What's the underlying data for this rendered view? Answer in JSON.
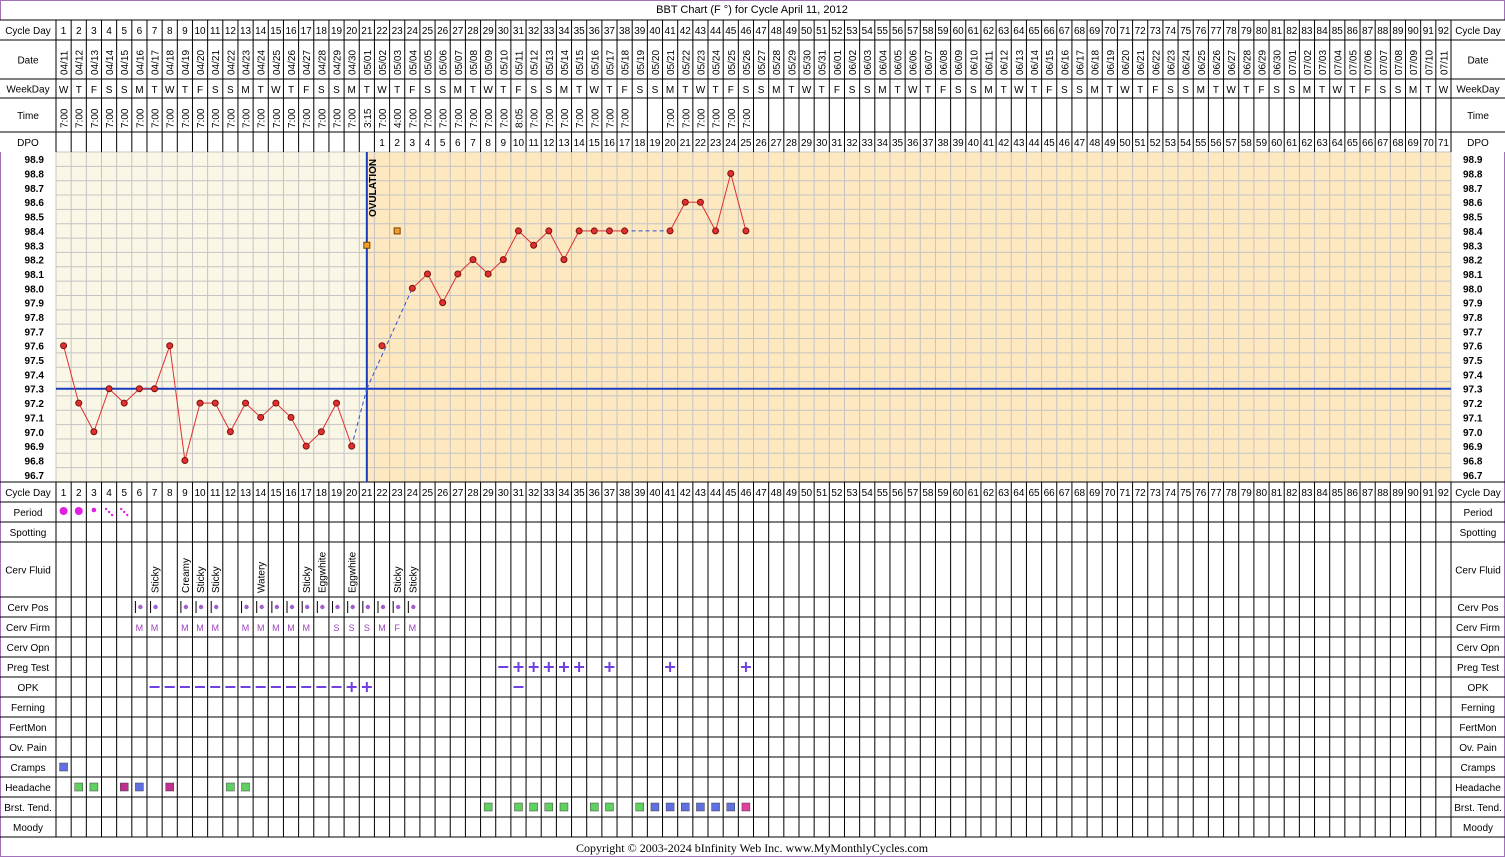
{
  "title": "BBT Chart (F °) for Cycle April 11, 2012",
  "copyright": "Copyright © 2003-2024 bInfinity Web Inc.     www.MyMonthlyCycles.com",
  "ovulation_label": "OVULATION",
  "row_labels": {
    "cycle_day": "Cycle Day",
    "date": "Date",
    "weekday": "WeekDay",
    "time": "Time",
    "dpo": "DPO",
    "period": "Period",
    "spotting": "Spotting",
    "cerv_fluid": "Cerv Fluid",
    "cerv_pos": "Cerv Pos",
    "cerv_firm": "Cerv Firm",
    "cerv_opn": "Cerv Opn",
    "preg_test": "Preg Test",
    "opk": "OPK",
    "ferning": "Ferning",
    "fertmon": "FertMon",
    "ov_pain": "Ov. Pain",
    "cramps": "Cramps",
    "headache": "Headache",
    "brst_tend": "Brst. Tend.",
    "moody": "Moody"
  },
  "colors": {
    "frame": "#a070b8",
    "pre_ov_bg": "#fbf7e6",
    "post_ov_bg": "#fde8c0",
    "grid": "#c4c4c4",
    "temp_line": "#e03030",
    "temp_dot": "#e03030",
    "coverline": "#1a3cc0",
    "ovulation_line": "#1a3cc0",
    "period": "#e020e0",
    "cerv_pos": "#a060d0",
    "cerv_firm": "#a040c0",
    "test_mark": "#7040e0",
    "sq_blue": "#6070e0",
    "sq_green": "#60d060",
    "sq_magenta": "#c03090",
    "sq_pink": "#e040a0",
    "sq_orange": "#f0a030"
  },
  "cycle_days": [
    1,
    2,
    3,
    4,
    5,
    6,
    7,
    8,
    9,
    10,
    11,
    12,
    13,
    14,
    15,
    16,
    17,
    18,
    19,
    20,
    21,
    22,
    23,
    24,
    25,
    26,
    27,
    28,
    29,
    30,
    31,
    32,
    33,
    34,
    35,
    36,
    37,
    38,
    39,
    40,
    41,
    42,
    43,
    44,
    45,
    46,
    47,
    48,
    49,
    50,
    51,
    52,
    53,
    54,
    55,
    56,
    57,
    58,
    59,
    60,
    61,
    62,
    63,
    64,
    65,
    66,
    67,
    68,
    69,
    70,
    71,
    72,
    73,
    74,
    75,
    76,
    77,
    78,
    79,
    80,
    81,
    82,
    83,
    84,
    85,
    86,
    87,
    88,
    89,
    90,
    91,
    92
  ],
  "dates": [
    "04/11",
    "04/12",
    "04/13",
    "04/14",
    "04/15",
    "04/16",
    "04/17",
    "04/18",
    "04/19",
    "04/20",
    "04/21",
    "04/22",
    "04/23",
    "04/24",
    "04/25",
    "04/26",
    "04/27",
    "04/28",
    "04/29",
    "04/30",
    "05/01",
    "05/02",
    "05/03",
    "05/04",
    "05/05",
    "05/06",
    "05/07",
    "05/08",
    "05/09",
    "05/10",
    "05/11",
    "05/12",
    "05/13",
    "05/14",
    "05/15",
    "05/16",
    "05/17",
    "05/18",
    "05/19",
    "05/20",
    "05/21",
    "05/22",
    "05/23",
    "05/24",
    "05/25",
    "05/26",
    "05/27",
    "05/28",
    "05/29",
    "05/30",
    "05/31",
    "06/01",
    "06/02",
    "06/03",
    "06/04",
    "06/05",
    "06/06",
    "06/07",
    "06/08",
    "06/09",
    "06/10",
    "06/11",
    "06/12",
    "06/13",
    "06/14",
    "06/15",
    "06/16",
    "06/17",
    "06/18",
    "06/19",
    "06/20",
    "06/21",
    "06/22",
    "06/23",
    "06/24",
    "06/25",
    "06/26",
    "06/27",
    "06/28",
    "06/29",
    "06/30",
    "07/01",
    "07/02",
    "07/03",
    "07/04",
    "07/05",
    "07/06",
    "07/07",
    "07/08",
    "07/09",
    "07/10",
    "07/11"
  ],
  "weekdays": [
    "W",
    "T",
    "F",
    "S",
    "S",
    "M",
    "T",
    "W",
    "T",
    "F",
    "S",
    "S",
    "M",
    "T",
    "W",
    "T",
    "F",
    "S",
    "S",
    "M",
    "T",
    "W",
    "T",
    "F",
    "S",
    "S",
    "M",
    "T",
    "W",
    "T",
    "F",
    "S",
    "S",
    "M",
    "T",
    "W",
    "T",
    "F",
    "S",
    "S",
    "M",
    "T",
    "W",
    "T",
    "F",
    "S",
    "S",
    "M",
    "T",
    "W",
    "T",
    "F",
    "S",
    "S",
    "M",
    "T",
    "W",
    "T",
    "F",
    "S",
    "S",
    "M",
    "T",
    "W",
    "T",
    "F",
    "S",
    "S",
    "M",
    "T",
    "W",
    "T",
    "F",
    "S",
    "S",
    "M",
    "T",
    "W",
    "T",
    "F",
    "S",
    "S",
    "M",
    "T",
    "W",
    "T",
    "F",
    "S",
    "S",
    "M",
    "T",
    "W"
  ],
  "times": [
    "7:00",
    "7:00",
    "7:00",
    "7:00",
    "7:00",
    "7:00",
    "7:00",
    "7:00",
    "7:00",
    "7:00",
    "7:00",
    "7:00",
    "7:00",
    "7:00",
    "7:00",
    "7:00",
    "7:00",
    "7:00",
    "7:00",
    "7:00",
    "3:15",
    "7:00",
    "4:00",
    "7:00",
    "7:00",
    "7:00",
    "7:00",
    "7:00",
    "7:00",
    "7:00",
    "8:05",
    "7:00",
    "7:00",
    "7:00",
    "7:00",
    "7:00",
    "7:00",
    "7:00",
    "",
    "",
    "7:00",
    "7:00",
    "7:00",
    "7:00",
    "7:00",
    "7:00"
  ],
  "dpo_start_day": 22,
  "dpo_count": 71,
  "y_ticks": [
    "98.9",
    "98.8",
    "98.7",
    "98.6",
    "98.5",
    "98.4",
    "98.3",
    "98.2",
    "98.1",
    "98.0",
    "97.9",
    "97.8",
    "97.7",
    "97.6",
    "97.5",
    "97.4",
    "97.3",
    "97.2",
    "97.1",
    "97.0",
    "96.9",
    "96.8",
    "96.7"
  ],
  "chart_data": {
    "type": "line",
    "title": "BBT Chart (F °) for Cycle April 11, 2012",
    "xlabel": "Cycle Day",
    "ylabel": "",
    "ylim": [
      96.7,
      98.9
    ],
    "x": [
      1,
      2,
      3,
      4,
      5,
      6,
      7,
      8,
      9,
      10,
      11,
      12,
      13,
      14,
      15,
      16,
      17,
      18,
      19,
      20,
      22,
      24,
      25,
      26,
      27,
      28,
      29,
      30,
      31,
      32,
      33,
      34,
      35,
      36,
      37,
      38,
      41,
      42,
      43,
      44,
      45,
      46
    ],
    "series": [
      {
        "values": [
          97.6,
          97.2,
          97.0,
          97.3,
          97.2,
          97.3,
          97.3,
          97.6,
          96.8,
          97.2,
          97.2,
          97.0,
          97.2,
          97.1,
          97.2,
          97.1,
          96.9,
          97.0,
          97.2,
          96.9,
          97.6,
          98.0,
          98.1,
          97.9,
          98.1,
          98.2,
          98.1,
          98.2,
          98.4,
          98.3,
          98.4,
          98.2,
          98.4,
          98.4,
          98.4,
          98.4,
          98.4,
          98.6,
          98.6,
          98.4,
          98.8,
          98.4
        ]
      }
    ],
    "dashed_segments": [
      [
        20,
        96.9,
        21,
        97.3
      ],
      [
        21,
        97.3,
        24,
        98.0
      ],
      [
        38,
        98.4,
        41,
        98.4
      ]
    ],
    "extra_points": [
      {
        "x": 21,
        "y": 98.3,
        "color": "orange"
      },
      {
        "x": 23,
        "y": 98.4,
        "color": "orange"
      }
    ],
    "coverline": 97.3,
    "ovulation_day": 21,
    "grid": true
  },
  "period_days": {
    "heavy": [
      1,
      2
    ],
    "medium": [
      3
    ],
    "light": [
      4,
      5
    ]
  },
  "cerv_fluid": [
    {
      "day": 7,
      "text": "Sticky"
    },
    {
      "day": 9,
      "text": "Creamy"
    },
    {
      "day": 10,
      "text": "Sticky"
    },
    {
      "day": 11,
      "text": "Sticky"
    },
    {
      "day": 14,
      "text": "Watery"
    },
    {
      "day": 17,
      "text": "Sticky"
    },
    {
      "day": 18,
      "text": "Eggwhite"
    },
    {
      "day": 20,
      "text": "Eggwhite"
    },
    {
      "day": 23,
      "text": "Sticky"
    },
    {
      "day": 24,
      "text": "Sticky"
    }
  ],
  "cerv_pos_days": [
    6,
    7,
    9,
    10,
    11,
    13,
    14,
    15,
    16,
    17,
    18,
    19,
    20,
    21,
    22,
    23,
    24
  ],
  "cerv_firm": [
    {
      "day": 6,
      "text": "M"
    },
    {
      "day": 7,
      "text": "M"
    },
    {
      "day": 9,
      "text": "M"
    },
    {
      "day": 10,
      "text": "M"
    },
    {
      "day": 11,
      "text": "M"
    },
    {
      "day": 13,
      "text": "M"
    },
    {
      "day": 14,
      "text": "M"
    },
    {
      "day": 15,
      "text": "M"
    },
    {
      "day": 16,
      "text": "M"
    },
    {
      "day": 17,
      "text": "M"
    },
    {
      "day": 19,
      "text": "S"
    },
    {
      "day": 20,
      "text": "S"
    },
    {
      "day": 21,
      "text": "S"
    },
    {
      "day": 22,
      "text": "M"
    },
    {
      "day": 23,
      "text": "F"
    },
    {
      "day": 24,
      "text": "M"
    }
  ],
  "preg_test": [
    {
      "day": 30,
      "result": "neg"
    },
    {
      "day": 31,
      "result": "pos"
    },
    {
      "day": 32,
      "result": "pos"
    },
    {
      "day": 33,
      "result": "pos"
    },
    {
      "day": 34,
      "result": "pos"
    },
    {
      "day": 35,
      "result": "pos"
    },
    {
      "day": 37,
      "result": "pos"
    },
    {
      "day": 41,
      "result": "pos"
    },
    {
      "day": 46,
      "result": "pos"
    }
  ],
  "opk": [
    {
      "day": 7,
      "result": "neg"
    },
    {
      "day": 8,
      "result": "neg"
    },
    {
      "day": 9,
      "result": "neg"
    },
    {
      "day": 10,
      "result": "neg"
    },
    {
      "day": 11,
      "result": "neg"
    },
    {
      "day": 12,
      "result": "neg"
    },
    {
      "day": 13,
      "result": "neg"
    },
    {
      "day": 14,
      "result": "neg"
    },
    {
      "day": 15,
      "result": "neg"
    },
    {
      "day": 16,
      "result": "neg"
    },
    {
      "day": 17,
      "result": "neg"
    },
    {
      "day": 18,
      "result": "neg"
    },
    {
      "day": 19,
      "result": "neg"
    },
    {
      "day": 20,
      "result": "pos"
    },
    {
      "day": 21,
      "result": "pos"
    },
    {
      "day": 31,
      "result": "neg"
    }
  ],
  "cramps": [
    {
      "day": 1,
      "color": "blue"
    }
  ],
  "headache": [
    {
      "day": 2,
      "color": "green"
    },
    {
      "day": 3,
      "color": "green"
    },
    {
      "day": 5,
      "color": "magenta"
    },
    {
      "day": 6,
      "color": "blue"
    },
    {
      "day": 8,
      "color": "magenta"
    },
    {
      "day": 12,
      "color": "green"
    },
    {
      "day": 13,
      "color": "green"
    }
  ],
  "brst_tend": [
    {
      "day": 29,
      "color": "green"
    },
    {
      "day": 31,
      "color": "green"
    },
    {
      "day": 32,
      "color": "green"
    },
    {
      "day": 33,
      "color": "green"
    },
    {
      "day": 34,
      "color": "green"
    },
    {
      "day": 36,
      "color": "green"
    },
    {
      "day": 37,
      "color": "green"
    },
    {
      "day": 39,
      "color": "green"
    },
    {
      "day": 40,
      "color": "blue"
    },
    {
      "day": 41,
      "color": "blue"
    },
    {
      "day": 42,
      "color": "blue"
    },
    {
      "day": 43,
      "color": "blue"
    },
    {
      "day": 44,
      "color": "blue"
    },
    {
      "day": 45,
      "color": "blue"
    },
    {
      "day": 46,
      "color": "pink"
    }
  ]
}
